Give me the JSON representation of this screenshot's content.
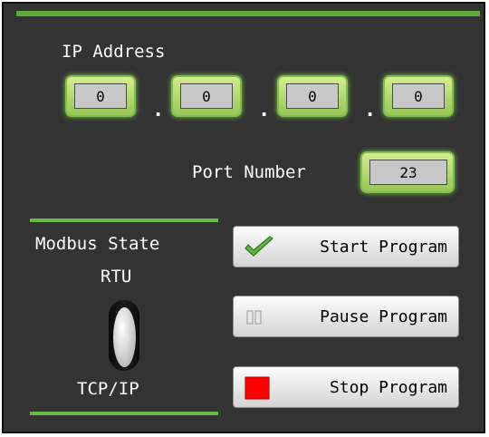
{
  "ip": {
    "label": "IP Address",
    "octets": [
      "0",
      "0",
      "0",
      "0"
    ],
    "separator": "."
  },
  "port": {
    "label": "Port Number",
    "value": "23"
  },
  "modbus": {
    "label": "Modbus State",
    "option_top": "RTU",
    "option_bottom": "TCP/IP",
    "selected": "TCP/IP"
  },
  "buttons": {
    "start": "Start Program",
    "pause": "Pause Program",
    "stop": "Stop Program"
  },
  "colors": {
    "background": "#333333",
    "accent_green": "#6abb45",
    "stop_red": "#ff0000"
  },
  "icons": {
    "start": "checkmark-icon",
    "pause": "pause-icon",
    "stop": "stop-square-icon"
  }
}
